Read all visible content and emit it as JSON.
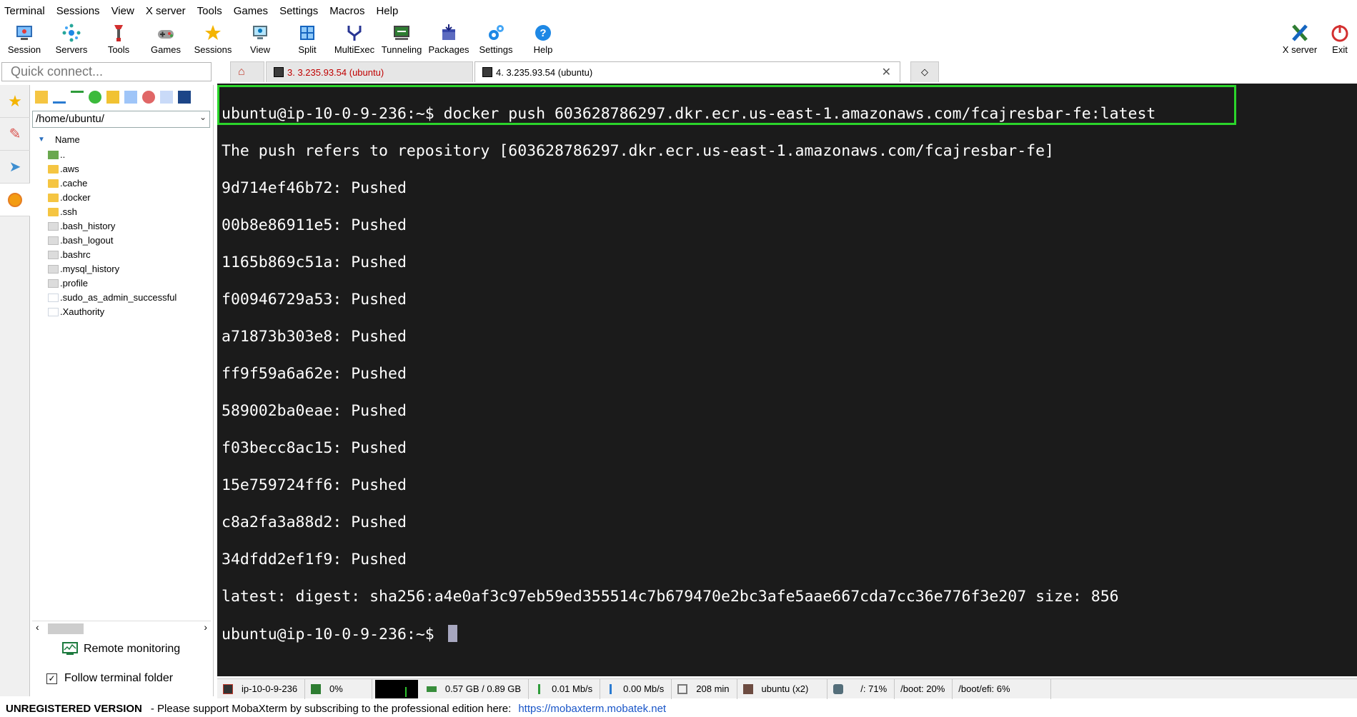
{
  "menubar": [
    "Terminal",
    "Sessions",
    "View",
    "X server",
    "Tools",
    "Games",
    "Settings",
    "Macros",
    "Help"
  ],
  "toolbar": {
    "buttons": [
      "Session",
      "Servers",
      "Tools",
      "Games",
      "Sessions",
      "View",
      "Split",
      "MultiExec",
      "Tunneling",
      "Packages",
      "Settings",
      "Help"
    ],
    "xserver_label": "X server",
    "exit_label": "Exit"
  },
  "quick_connect": {
    "placeholder": "Quick connect..."
  },
  "sidebar": {
    "path": "/home/ubuntu/",
    "tree_header": "Name",
    "items": [
      {
        "name": "..",
        "type": "up"
      },
      {
        "name": ".aws",
        "type": "folder"
      },
      {
        "name": ".cache",
        "type": "folder"
      },
      {
        "name": ".docker",
        "type": "folder"
      },
      {
        "name": ".ssh",
        "type": "folder"
      },
      {
        "name": ".bash_history",
        "type": "file"
      },
      {
        "name": ".bash_logout",
        "type": "file"
      },
      {
        "name": ".bashrc",
        "type": "file"
      },
      {
        "name": ".mysql_history",
        "type": "file"
      },
      {
        "name": ".profile",
        "type": "file"
      },
      {
        "name": ".sudo_as_admin_successful",
        "type": "blank"
      },
      {
        "name": ".Xauthority",
        "type": "blank"
      }
    ],
    "remote_monitoring": "Remote monitoring",
    "follow_folder": "Follow terminal folder",
    "follow_checked": true
  },
  "tabs": {
    "tab3": "3. 3.235.93.54 (ubuntu)",
    "tab4": "4. 3.235.93.54 (ubuntu)",
    "close": "✕",
    "plus": "◇"
  },
  "terminal": {
    "lines": [
      "ubuntu@ip-10-0-9-236:~$ docker push 603628786297.dkr.ecr.us-east-1.amazonaws.com/fcajresbar-fe:latest",
      "The push refers to repository [603628786297.dkr.ecr.us-east-1.amazonaws.com/fcajresbar-fe]",
      "9d714ef46b72: Pushed",
      "00b8e86911e5: Pushed",
      "1165b869c51a: Pushed",
      "f00946729a53: Pushed",
      "a71873b303e8: Pushed",
      "ff9f59a6a62e: Pushed",
      "589002ba0eae: Pushed",
      "f03becc8ac15: Pushed",
      "15e759724ff6: Pushed",
      "c8a2fa3a88d2: Pushed",
      "34dfdd2ef1f9: Pushed",
      "latest: digest: sha256:a4e0af3c97eb59ed355514c7b679470e2bc3afe5aae667cda7cc36e776f3e207 size: 856"
    ],
    "prompt": "ubuntu@ip-10-0-9-236:~$ "
  },
  "statusbar": {
    "host": "ip-10-0-9-236",
    "cpu": "0%",
    "mem": "0.57 GB / 0.89 GB",
    "up": "0.01 Mb/s",
    "down": "0.00 Mb/s",
    "uptime": "208 min",
    "user": "ubuntu (x2)",
    "disk_root": "/: 71%",
    "disk_boot": "/boot: 20%",
    "disk_efi": "/boot/efi: 6%"
  },
  "footer": {
    "unregistered": "UNREGISTERED VERSION",
    "message": "-  Please support MobaXterm by subscribing to the professional edition here:",
    "link": "https://mobaxterm.mobatek.net"
  },
  "colors": {
    "accent_green": "#2bd52b",
    "terminal_bg": "#1b1b1b",
    "tab_red": "#c00000"
  }
}
